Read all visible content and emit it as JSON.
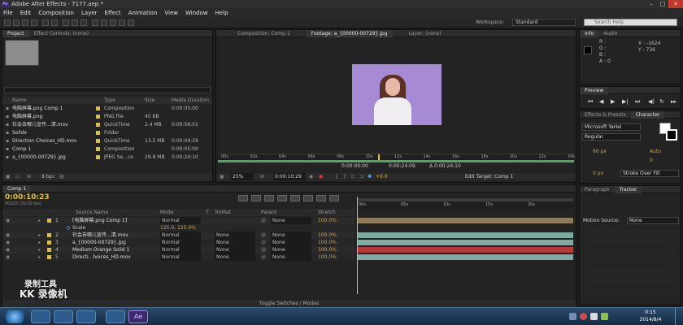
{
  "app": {
    "title": "Adobe After Effects - 7177.aep *",
    "badge": "Ae"
  },
  "menu": [
    "File",
    "Edit",
    "Composition",
    "Layer",
    "Effect",
    "Animation",
    "View",
    "Window",
    "Help"
  ],
  "toolbar": {
    "workspace_label": "Workspace:",
    "workspace_value": "Standard",
    "search_placeholder": "Search Help"
  },
  "project": {
    "tabs": [
      "Project",
      "Effect Controls: (none)"
    ],
    "columns": [
      "Name",
      "Type",
      "Size",
      "Media Duration"
    ],
    "items": [
      {
        "name": "电脑屏幕.png Comp 1",
        "type": "Composition",
        "size": "",
        "dur": "0:00:05:00",
        "color": "#d9c04a"
      },
      {
        "name": "电脑屏幕.png",
        "type": "PNG file",
        "size": "45 KB",
        "dur": "",
        "color": "#d9c04a"
      },
      {
        "name": "社会去哪儿宣传...清.mov",
        "type": "QuickTime",
        "size": "2.4 MB",
        "dur": "0:00:56:01",
        "color": "#d9c04a"
      },
      {
        "name": "Solids",
        "type": "Folder",
        "size": "",
        "dur": "",
        "color": "#d9c04a"
      },
      {
        "name": "Direction Choices_HD.mov",
        "type": "QuickTime",
        "size": "13.5 MB",
        "dur": "0:00:04:29",
        "color": "#d9c04a"
      },
      {
        "name": "Comp 1",
        "type": "Composition",
        "size": "",
        "dur": "0:00:05:00",
        "color": "#d9c04a"
      },
      {
        "name": "a_{00000-00729}.jpg",
        "type": "JPEG Se...ce",
        "size": "29.8 MB",
        "dur": "0:00:24:10",
        "color": "#d9c04a"
      }
    ],
    "footer_bpc": "8 bpc"
  },
  "viewer": {
    "tabs": [
      "Composition: Comp 1",
      "Footage: a_{00000-00729}.jpg",
      "Layer: (none)"
    ],
    "ruler_ticks": [
      "00s",
      "02s",
      "04s",
      "06s",
      "08s",
      "10s",
      "12s",
      "14s",
      "16s",
      "18s",
      "20s",
      "22s",
      "24s"
    ],
    "time_current": "0:00:00:00",
    "time_end": "0:00:24:09",
    "time_duration": "Δ 0:00:24:10",
    "zoom": "25%",
    "timecode": "0:00:10:29",
    "offset": "+0.0",
    "edit_target": "Edit Target: Comp 1"
  },
  "info": {
    "tabs": [
      "Info",
      "Audio"
    ],
    "labels": [
      "R :",
      "G :",
      "B :",
      "A : 0"
    ],
    "x": "X : -1624",
    "y": "Y : 736"
  },
  "preview": {
    "tab": "Preview"
  },
  "effects": {
    "tabs": [
      "Effects & Presets",
      "Character"
    ],
    "font": "Microsoft YaHei",
    "style": "Regular",
    "size": "60 px",
    "leading": "Auto",
    "tracking": "0",
    "stroke_width": "0 px",
    "stroke_type": "Stroke Over Fill"
  },
  "tracker": {
    "tabs": [
      "Paragraph",
      "Tracker"
    ],
    "motion_source_label": "Motion Source:",
    "motion_source_value": "None"
  },
  "timeline": {
    "tab": "Comp 1",
    "timecode": "0:00:10:23",
    "fps": "00323 (30.00 fps)",
    "columns": [
      "Source Name",
      "Mode",
      "T",
      "TrkMat",
      "Parent",
      "Stretch"
    ],
    "ticks": [
      "00s",
      "05s",
      "10s",
      "15s",
      "20s"
    ],
    "layers": [
      {
        "num": "1",
        "name": "[电脑屏幕.png Comp 1]",
        "mode": "Normal",
        "trk": "",
        "parent": "None",
        "stretch": "100.0%",
        "color": "#8c7a5a"
      },
      {
        "num": "",
        "name": "Scale",
        "mode": "",
        "trk": "",
        "parent": "",
        "stretch": "",
        "color": "",
        "scale_value": "125.0, 125.0%"
      },
      {
        "num": "2",
        "name": "社会去哪儿宣传...清.mov",
        "mode": "Normal",
        "trk": "None",
        "parent": "None",
        "stretch": "100.0%",
        "color": "#7fa9a3"
      },
      {
        "num": "3",
        "name": "a_{00000-00729}.jpg",
        "mode": "Normal",
        "trk": "None",
        "parent": "None",
        "stretch": "100.0%",
        "color": "#7fa9a3"
      },
      {
        "num": "4",
        "name": "Medium Orange Solid 1",
        "mode": "Normal",
        "trk": "None",
        "parent": "None",
        "stretch": "100.0%",
        "color": "#b83a3a"
      },
      {
        "num": "5",
        "name": "Directi...hoices_HD.mov",
        "mode": "Normal",
        "trk": "None",
        "parent": "None",
        "stretch": "100.0%",
        "color": "#7fa9a3"
      }
    ],
    "footer": "Toggle Switches / Modes"
  },
  "watermark": {
    "line1": "录制工具",
    "line2": "KK 录像机"
  },
  "taskbar": {
    "time": "0:15",
    "date": "2014/8/4"
  }
}
